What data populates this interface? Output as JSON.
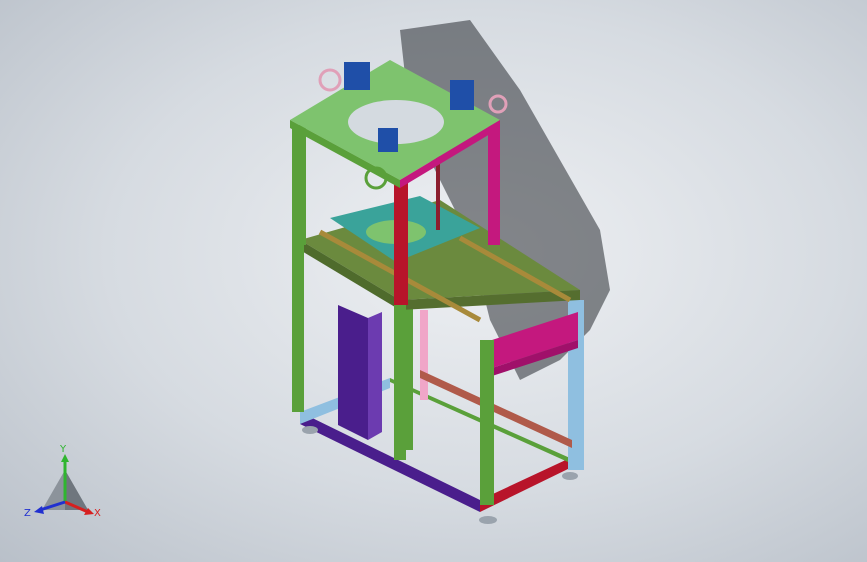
{
  "viewport": {
    "background_top": "#eef0f3",
    "background_bottom": "#b9c0c9"
  },
  "model": {
    "frame_colors": {
      "green_post": "#5aa03a",
      "red_post": "#b8142a",
      "magenta": "#c4187e",
      "purple": "#4a1e8c",
      "top_plate": "#7ec36e",
      "mid_plate": "#3aa39a",
      "table_plate": "#6b8a3e",
      "light_blue": "#8fbfe0",
      "gearbox": "#1f4fa8",
      "pink": "#f0a6c8"
    }
  },
  "triad": {
    "y_label": "Y",
    "x_label": "X",
    "z_label": "Z",
    "y_color": "#2fb52f",
    "x_color": "#d62020",
    "z_color": "#2030d0"
  }
}
